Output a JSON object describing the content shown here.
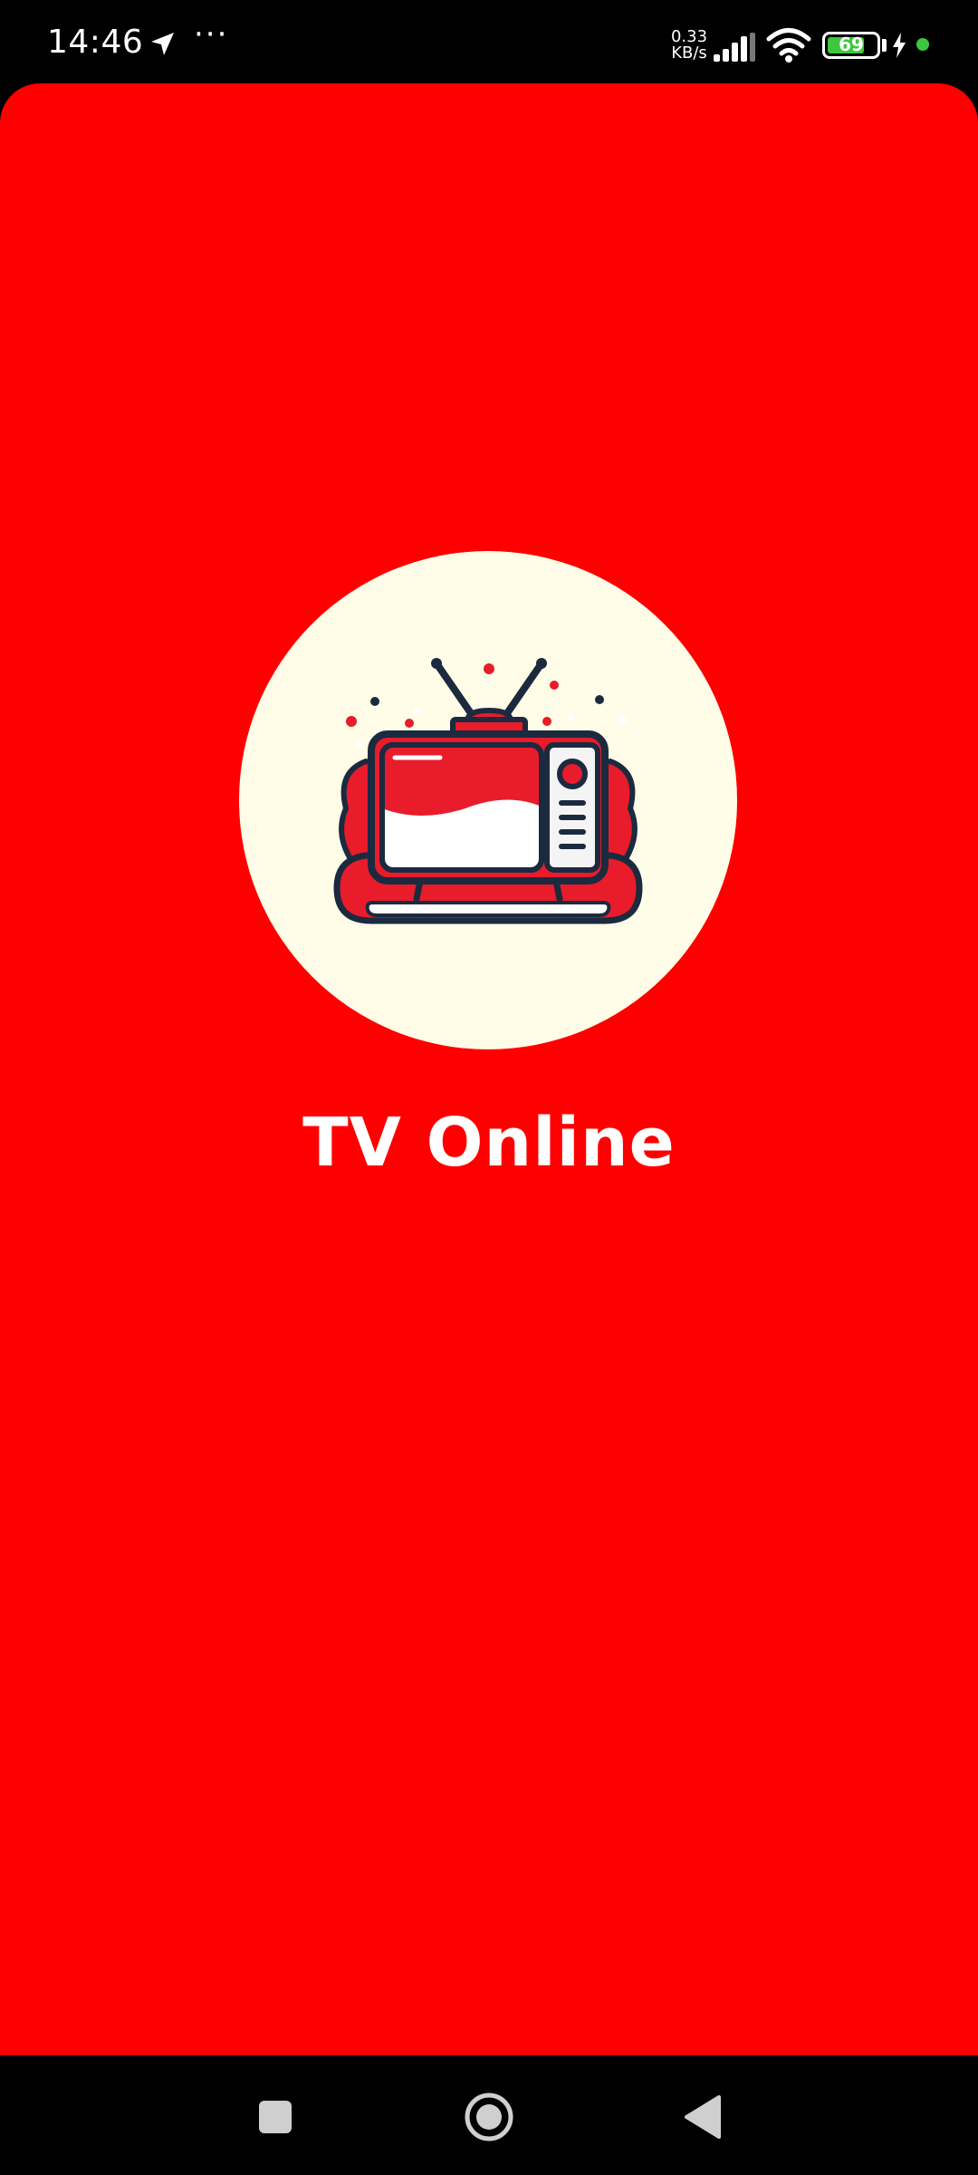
{
  "status_bar": {
    "time": "14:46",
    "more_indicator": "···",
    "network_speed_value": "0.33",
    "network_speed_unit": "KB/s",
    "battery_level": "69",
    "icons": [
      "location-arrow-icon",
      "signal-bars-icon",
      "wifi-icon",
      "battery-icon",
      "charging-bolt-icon",
      "privacy-indicator-dot"
    ]
  },
  "splash": {
    "app_name": "TV Online",
    "logo": "retro-tv-logo",
    "background_color": "#ff0000",
    "logo_circle_color": "#fffde8"
  },
  "navigation_bar": {
    "buttons": [
      "recents-button",
      "home-button",
      "back-button"
    ]
  }
}
